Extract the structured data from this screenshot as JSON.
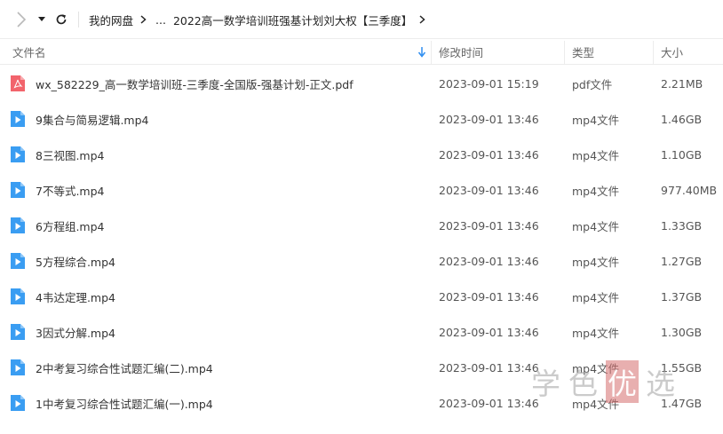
{
  "toolbar": {
    "breadcrumbs": [
      "我的网盘",
      "...",
      "2022高一数学培训班强基计划刘大权【三季度】"
    ]
  },
  "columns": {
    "name": "文件名",
    "modified": "修改时间",
    "type": "类型",
    "size": "大小"
  },
  "files": [
    {
      "name": "wx_582229_高一数学培训班-三季度-全国版-强基计划-正文.pdf",
      "modified": "2023-09-01 15:19",
      "type": "pdf文件",
      "size": "2.21MB",
      "icon": "pdf-icon"
    },
    {
      "name": "9集合与简易逻辑.mp4",
      "modified": "2023-09-01 13:46",
      "type": "mp4文件",
      "size": "1.46GB",
      "icon": "video-icon"
    },
    {
      "name": "8三视图.mp4",
      "modified": "2023-09-01 13:46",
      "type": "mp4文件",
      "size": "1.10GB",
      "icon": "video-icon"
    },
    {
      "name": "7不等式.mp4",
      "modified": "2023-09-01 13:46",
      "type": "mp4文件",
      "size": "977.40MB",
      "icon": "video-icon"
    },
    {
      "name": "6方程组.mp4",
      "modified": "2023-09-01 13:46",
      "type": "mp4文件",
      "size": "1.33GB",
      "icon": "video-icon"
    },
    {
      "name": "5方程综合.mp4",
      "modified": "2023-09-01 13:46",
      "type": "mp4文件",
      "size": "1.27GB",
      "icon": "video-icon"
    },
    {
      "name": "4韦达定理.mp4",
      "modified": "2023-09-01 13:46",
      "type": "mp4文件",
      "size": "1.37GB",
      "icon": "video-icon"
    },
    {
      "name": "3因式分解.mp4",
      "modified": "2023-09-01 13:46",
      "type": "mp4文件",
      "size": "1.30GB",
      "icon": "video-icon"
    },
    {
      "name": "2中考复习综合性试题汇编(二).mp4",
      "modified": "2023-09-01 13:46",
      "type": "mp4文件",
      "size": "1.55GB",
      "icon": "video-icon"
    },
    {
      "name": "1中考复习综合性试题汇编(一).mp4",
      "modified": "2023-09-01 13:46",
      "type": "mp4文件",
      "size": "1.47GB",
      "icon": "video-icon"
    }
  ],
  "watermark": {
    "part1": "学",
    "part2": "色",
    "highlight": "优",
    "part3": "选"
  },
  "colors": {
    "pdf": "#f2646c",
    "video": "#3a9df2",
    "sort_arrow": "#2f8ef0"
  }
}
